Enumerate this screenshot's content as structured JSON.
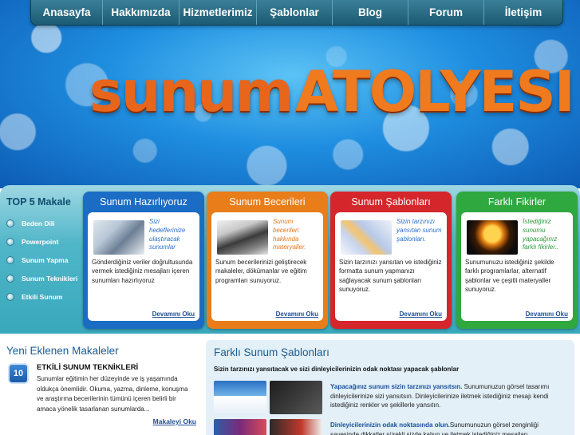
{
  "nav": {
    "items": [
      "Anasayfa",
      "Hakkımızda",
      "Hizmetlerimiz",
      "Şablonlar",
      "Blog",
      "Forum",
      "İletişim"
    ]
  },
  "logo": {
    "part1": "sunum",
    "part2": "ATOLYESI"
  },
  "top5": {
    "title": "TOP 5 Makale",
    "items": [
      "Beden Dili",
      "Powerpoint",
      "Sunum Yapma",
      "Sunum Teknikleri",
      "Etkili Sunum"
    ]
  },
  "cards": [
    {
      "title": "Sunum Hazırlıyoruz",
      "quote": "Sizi hedeflerinize ulaştıracak sunumlar",
      "text": "Gönderdiğiniz veriler doğrultusunda vermek istediğiniz mesajları içeren sunumları hazırlıyoruz",
      "more": "Devamını Oku",
      "color": "#1a6cc4",
      "quote_color": "#2a6fc9"
    },
    {
      "title": "Sunum Becerileri",
      "quote": "Sunum becerileri hakkında materyaller.",
      "text": "Sunum becerilerinizi geliştirecek makaleler, dökümanlar ve eğitim programları sunuyoruz.",
      "more": "Devamını Oku",
      "color": "#e97d1a",
      "quote_color": "#e7771a"
    },
    {
      "title": "Sunum Şablonları",
      "quote": "Sizin tarzınızı yansıtan sunum şablonları.",
      "text": "Sizin tarzınızı yansıtan ve istediğiniz formatta sunum yapmanızı sağlayacak sunum şablonları sunuyoruz.",
      "more": "Devamını Oku",
      "color": "#d5262b",
      "quote_color": "#2a6fc9"
    },
    {
      "title": "Farklı Fikirler",
      "quote": "İstediğiniz sunumu yapacağınız farklı fikirler..",
      "text": "Sunumunuzu istediğiniz şekilde farklı programlarlar, alternatif şablonlar ve çeşitli materyaller sunuyoruz.",
      "more": "Devamını Oku",
      "color": "#2fa83f",
      "quote_color": "#2a9a3a"
    }
  ],
  "recent": {
    "title": "Yeni Eklenen Makaleler",
    "article": {
      "number": "10",
      "title": "ETKİLİ SUNUM TEKNİKLERİ",
      "text": "Sunumlar eğitimin her düzeyinde ve iş yaşamında oldukça önemlidir. Okuma, yazma, dinleme, konuşma ve araştırma becerilerinin tümünü içeren belirli bir amaca yönelik tasarlanan sunumlarda...",
      "more": "Makaleyi Oku"
    }
  },
  "templates": {
    "title": "Farklı Sunum Şablonları",
    "subtitle": "Sizin tarzınızı yansıtacak ve sizi dinleyicilerinizin odak noktası yapacak şablonlar",
    "rows": [
      {
        "lead": "Yapacağınız sunum sizin tarzınızı yansıtsın.",
        "text": " Sunumunuzun görsel tasarımı dinleyicilerinize sizi yansıtsın. Dinleyicilerinize iletmek istediğiniz mesajı kendi istediğiniz renkler ve şekillerle yansıtın."
      },
      {
        "lead": "Dinleyicilerinizin odak noktasında olun.",
        "text": "Sunumunuzun görsel zenginliği sayesinde dikkatler sürekli sizde kalsın ve iletmek istediğiniz mesajları"
      }
    ]
  }
}
